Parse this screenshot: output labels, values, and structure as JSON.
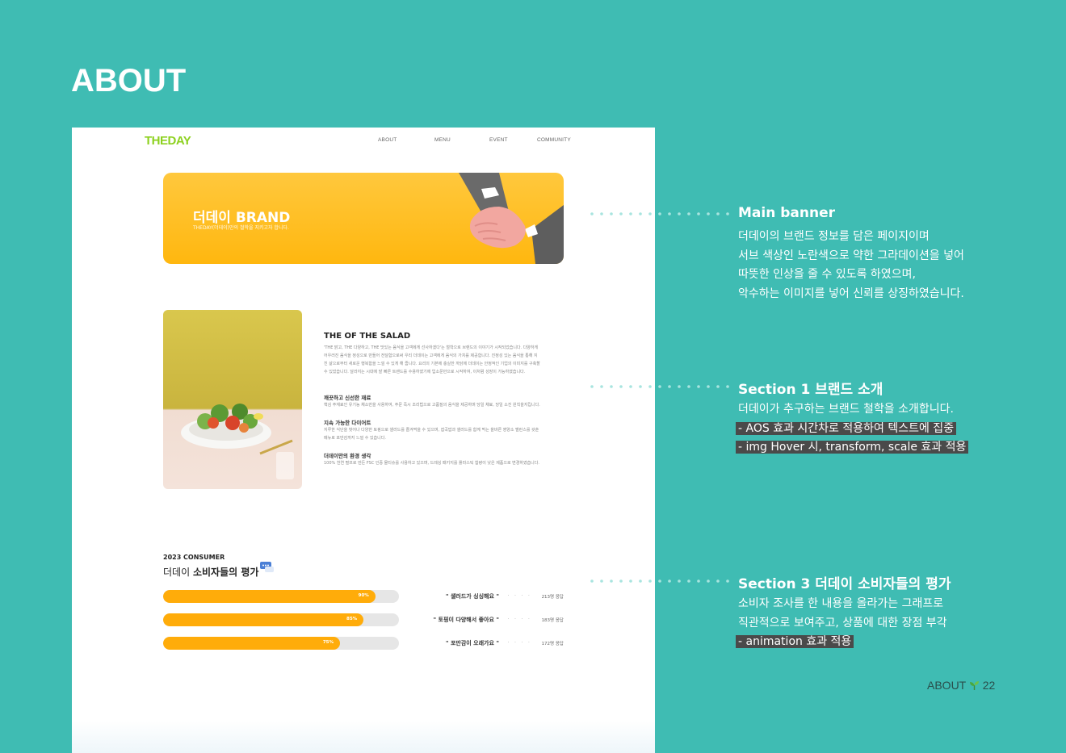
{
  "page": {
    "title": "ABOUT"
  },
  "mockup": {
    "logo": "THEDAY",
    "nav": [
      "ABOUT",
      "MENU",
      "EVENT",
      "COMMUNITY"
    ],
    "banner": {
      "title": "더데이 BRAND",
      "subtitle": "THEDAY(더데이)만의 철학을 지키고자 합니다."
    },
    "section1": {
      "title": "THE OF THE SALAD",
      "intro": [
        "'THE 맑고, THE 다양하고, THE 맛있는 음식을 고객에게 선사하겠다'는 철학으로 브랜드의 이야기가 시작되었습니다. 다양하게",
        "어우러진 음식을 정성으로 만들어 전달함으로써 우리 더데이는 고객에게 음식의 가치를 제공합니다. 진정성 있는 음식을 통해 지",
        "친 삶으로부터 새로운 행복함을 느낄 수 있게 해 줍니다. 요리의 기본에 충실한 까닭에 더데이는 안정적인 기업의 이미지를 구축할",
        "수 있었습니다. 달라지는 시대에 발 빠른 트렌드를 수용하였기에 입소문만으로 시작하여, 이처럼 성장이 가능하였습니다."
      ],
      "points": [
        {
          "heading": "깨끗하고 신선한 재료",
          "lines": [
            "핵심 주재료인 유기농 채소만을 사용하여, 주문 즉시 조리법으로 고품질의 음식을 제공하며 당일 채료, 당일 소진 원칙을지킵니다."
          ]
        },
        {
          "heading": "지속 가능한 다이어트",
          "lines": [
            "지루한 식단을 벗어나 다양한 토핑으로 샐러드를 즐겨먹을 수 있으며, 잡곡밥과 샐러드를 함께 먹는 올바른 영양소 밸런스를 갖춘",
            "메뉴로 포만감까지 느낄 수 있습니다."
          ]
        },
        {
          "heading": "더데이만의 환경 생각",
          "lines": [
            "100% 천연 펄프로 만든 FSC 인증 물티슈를 사용하고 있으며, 드레싱 패키지를 플라스틱 함량이 낮은 제품으로 변경하였습니다."
          ]
        }
      ]
    },
    "consumer": {
      "label": "2023 CONSUMER",
      "title_prefix": "더데이",
      "title_main": "소비자들의 평가",
      "bars": [
        {
          "pct_label": "90%",
          "value": 0.9,
          "quote": "\" 샐러드가 싱싱해요 \"",
          "count": "213명 응답"
        },
        {
          "pct_label": "85%",
          "value": 0.85,
          "quote": "\" 토핑이 다양해서 좋아요 \"",
          "count": "183명 응답"
        },
        {
          "pct_label": "75%",
          "value": 0.75,
          "quote": "\" 포만감이 오래가요 \"",
          "count": "172명 응답"
        }
      ]
    }
  },
  "annotations": [
    {
      "title": "Main banner",
      "lines": [
        {
          "text": "더데이의 브랜드 정보를 담은 페이지이며",
          "highlight": false
        },
        {
          "text": "서브 색상인 노란색으로 약한 그라데이션을 넣어",
          "highlight": false
        },
        {
          "text": "따뜻한 인상을 줄 수 있도록 하였으며,",
          "highlight": false
        },
        {
          "text": "악수하는 이미지를 넣어 신뢰를 상징하였습니다.",
          "highlight": false
        }
      ]
    },
    {
      "title": "Section 1 브랜드 소개",
      "lines": [
        {
          "text": "더데이가 추구하는 브랜드 철학을 소개합니다.",
          "highlight": false
        },
        {
          "text": "- AOS 효과 시간차로 적용하여 텍스트에 집중",
          "highlight": true
        },
        {
          "text": "- img Hover 시, transform, scale 효과 적용",
          "highlight": true
        }
      ]
    },
    {
      "title": "Section 3 더데이 소비자들의 평가",
      "lines": [
        {
          "text": "소비자 조사를 한 내용을 올라가는 그래프로",
          "highlight": false
        },
        {
          "text": "직관적으로 보여주고, 상품에 대한 장점 부각",
          "highlight": false
        },
        {
          "text": "- animation 효과 적용",
          "highlight": true
        }
      ]
    }
  ],
  "footer": {
    "label": "ABOUT",
    "icon": "sprout-icon",
    "page_number": "22"
  },
  "colors": {
    "background": "#3fbcb3",
    "logo_green": "#8dd11f",
    "banner_yellow": "#ffb70f",
    "bar_orange": "#ffac0a",
    "highlight": "#4a4a4a"
  }
}
